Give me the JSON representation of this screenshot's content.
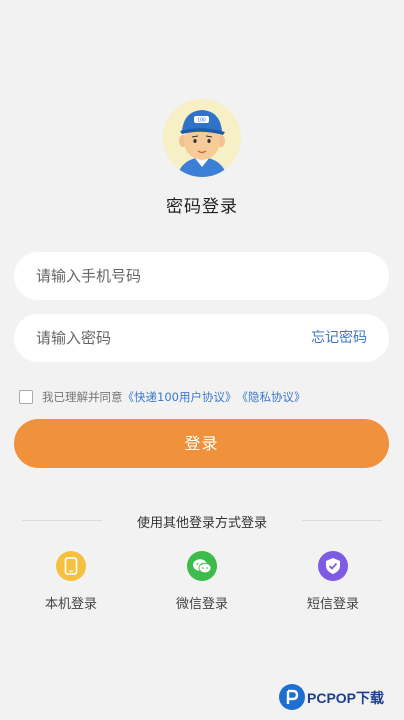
{
  "login": {
    "title": "密码登录",
    "phone_placeholder": "请输入手机号码",
    "password_placeholder": "请输入密码",
    "forgot_label": "忘记密码",
    "agree_prefix": "我已理解并同意",
    "agree_terms": "《快递100用户协议》",
    "agree_privacy": "《隐私协议》",
    "login_label": "登录",
    "accent_color": "#f0913b",
    "link_color": "#3c78c9"
  },
  "other_methods": {
    "label": "使用其他登录方式登录",
    "items": [
      {
        "label": "本机登录",
        "icon": "phone-icon",
        "color": "#f5c03e"
      },
      {
        "label": "微信登录",
        "icon": "wechat-icon",
        "color": "#3dbb4b"
      },
      {
        "label": "短信登录",
        "icon": "shield-check-icon",
        "color": "#7e5be3"
      }
    ]
  },
  "watermark": {
    "text": "PCPOP下载",
    "icon": "pcpop-logo-icon"
  }
}
